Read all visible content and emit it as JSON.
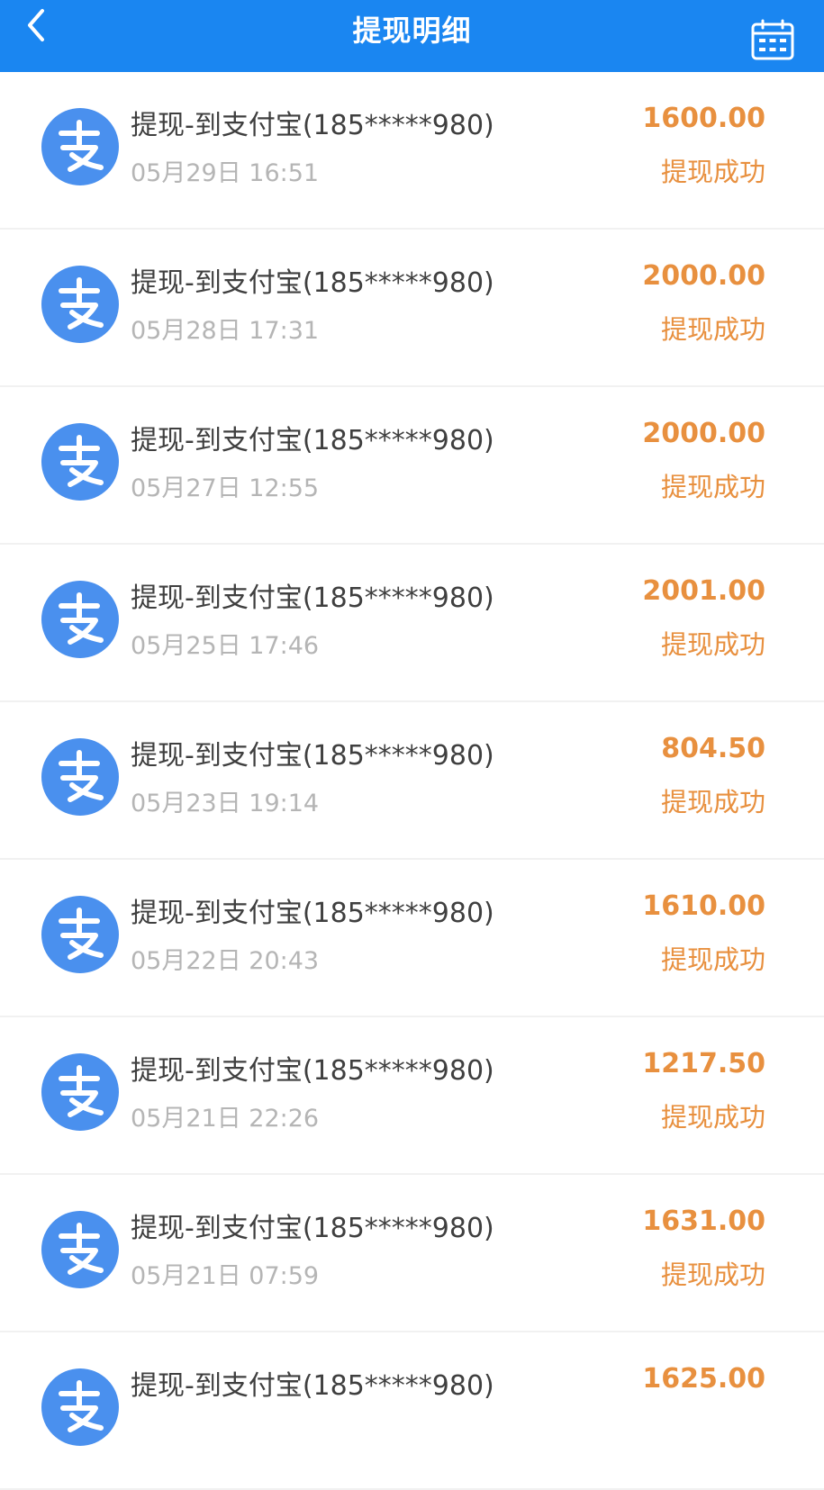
{
  "header": {
    "title": "提现明细",
    "back_icon": "chevron-left-icon",
    "calendar_icon": "calendar-icon"
  },
  "colors": {
    "header_bg": "#1a86f1",
    "accent_orange": "#e8903f",
    "alipay_blue": "#4a90ee"
  },
  "items": [
    {
      "desc": "提现-到支付宝(185*****980)",
      "time": "05月29日 16:51",
      "amount": "1600.00",
      "status": "提现成功"
    },
    {
      "desc": "提现-到支付宝(185*****980)",
      "time": "05月28日 17:31",
      "amount": "2000.00",
      "status": "提现成功"
    },
    {
      "desc": "提现-到支付宝(185*****980)",
      "time": "05月27日 12:55",
      "amount": "2000.00",
      "status": "提现成功"
    },
    {
      "desc": "提现-到支付宝(185*****980)",
      "time": "05月25日 17:46",
      "amount": "2001.00",
      "status": "提现成功"
    },
    {
      "desc": "提现-到支付宝(185*****980)",
      "time": "05月23日 19:14",
      "amount": "804.50",
      "status": "提现成功"
    },
    {
      "desc": "提现-到支付宝(185*****980)",
      "time": "05月22日 20:43",
      "amount": "1610.00",
      "status": "提现成功"
    },
    {
      "desc": "提现-到支付宝(185*****980)",
      "time": "05月21日 22:26",
      "amount": "1217.50",
      "status": "提现成功"
    },
    {
      "desc": "提现-到支付宝(185*****980)",
      "time": "05月21日 07:59",
      "amount": "1631.00",
      "status": "提现成功"
    },
    {
      "desc": "提现-到支付宝(185*****980)",
      "time": "",
      "amount": "1625.00",
      "status": ""
    }
  ]
}
